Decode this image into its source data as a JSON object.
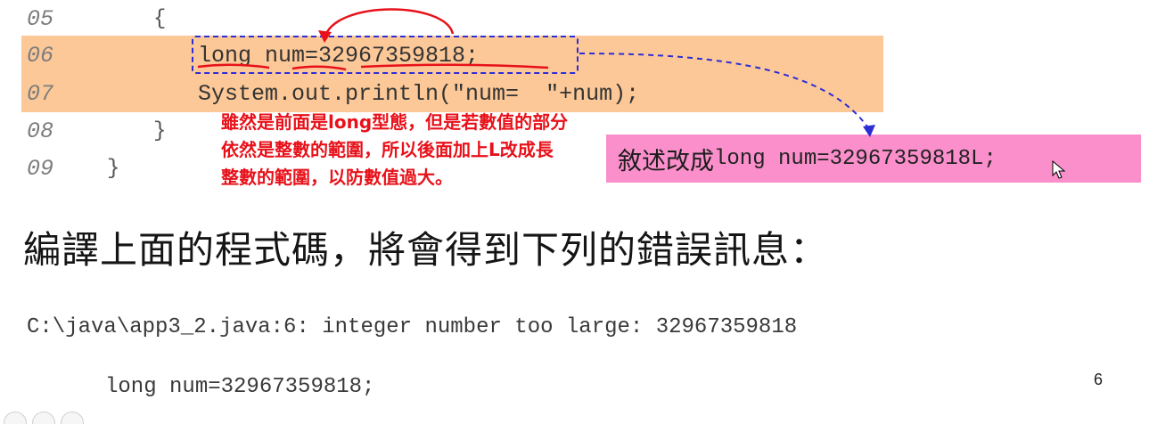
{
  "slide": {
    "code_lines": [
      {
        "no": "05",
        "text": "{"
      },
      {
        "no": "06",
        "text": "long num=32967359818;"
      },
      {
        "no": "07",
        "text": "System.out.println(\"num=  \"+num);"
      },
      {
        "no": "08",
        "text": "}"
      },
      {
        "no": "09",
        "text": "}"
      }
    ],
    "annotation": "雖然是前面是long型態，但是若數值的部分依然是整數的範圍，所以後面加上L改成長整數的範圍，以防數值過大。",
    "callout": {
      "label": "敘述改成",
      "code": "long num=32967359818L;"
    },
    "heading": "編譯上面的程式碼，將會得到下列的錯誤訊息：",
    "error_lines": [
      "C:\\java\\app3_2.java:6: integer number too large: 32967359818",
      "long num=32967359818;"
    ],
    "page_number": "6"
  },
  "colors": {
    "highlight_band": "#fcc898",
    "annotation_text": "#e8111a",
    "callout_bg": "#fa8fcb",
    "dashed_box": "#2d2dd6",
    "red_marks": "#e8111a"
  },
  "icons": {
    "cursor": "mouse-pointer-icon"
  }
}
